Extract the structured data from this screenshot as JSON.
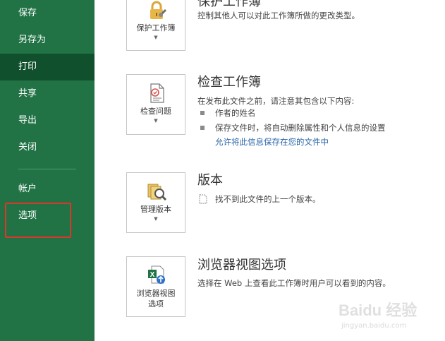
{
  "sidebar": {
    "items": [
      {
        "label": "保存"
      },
      {
        "label": "另存为"
      },
      {
        "label": "打印"
      },
      {
        "label": "共享"
      },
      {
        "label": "导出"
      },
      {
        "label": "关闭"
      },
      {
        "label": "帐户"
      },
      {
        "label": "选项"
      }
    ],
    "highlight_color": "#e0352b",
    "bg_color": "#217346",
    "active_color": "#10502c"
  },
  "sections": {
    "protect": {
      "title": "保护工作簿",
      "description": "控制其他人可以对此工作簿所做的更改类型。",
      "button_label": "保护工作簿",
      "icon": "lock-icon"
    },
    "inspect": {
      "title": "检查工作簿",
      "description": "在发布此文件之前，请注意其包含以下内容:",
      "bullets": [
        "作者的姓名",
        "保存文件时，将自动删除属性和个人信息的设置"
      ],
      "link": "允许将此信息保存在您的文件中",
      "button_label": "检查问题",
      "icon": "inspect-document-icon"
    },
    "versions": {
      "title": "版本",
      "description": "找不到此文件的上一个版本。",
      "button_label": "管理版本",
      "icon": "manage-versions-icon"
    },
    "browser": {
      "title": "浏览器视图选项",
      "description": "选择在 Web 上查看此工作簿时用户可以看到的内容。",
      "button_label_line1": "浏览器视图",
      "button_label_line2": "选项",
      "icon": "excel-web-icon"
    }
  },
  "watermark": {
    "brand": "Baidu 经验",
    "url": "jingyan.baidu.com"
  }
}
